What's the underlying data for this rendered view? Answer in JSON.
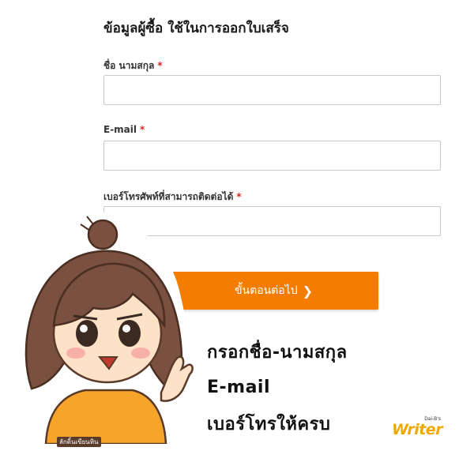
{
  "form": {
    "title": "ข้อมูลผู้ซื้อ ใช้ในการออกใบเสร็จ",
    "required_mark": "*",
    "fields": [
      {
        "label": "ชื่อ นามสกุล",
        "value": ""
      },
      {
        "label": "E-mail",
        "value": ""
      },
      {
        "label": "เบอร์โทรศัพท์ที่สามารถติดต่อได้",
        "value": ""
      }
    ],
    "next_button": {
      "label": "ขั้นตอนต่อไป",
      "icon": "chevron-right-icon"
    }
  },
  "overlay": {
    "caption_lines": [
      "กรอกชื่อ-นามสกุล",
      "E-mail",
      "เบอร์โทรให้ครบ"
    ],
    "watermark": "ลักดิ้นเขียนหิน",
    "logo": {
      "small_text": "Dai-B's",
      "word": "Writer"
    }
  },
  "colors": {
    "accent": "#f47c00",
    "required": "#d62828",
    "logo": "#f0a800",
    "mascot_shirt": "#f7a42a",
    "mascot_hair": "#7a5040"
  }
}
